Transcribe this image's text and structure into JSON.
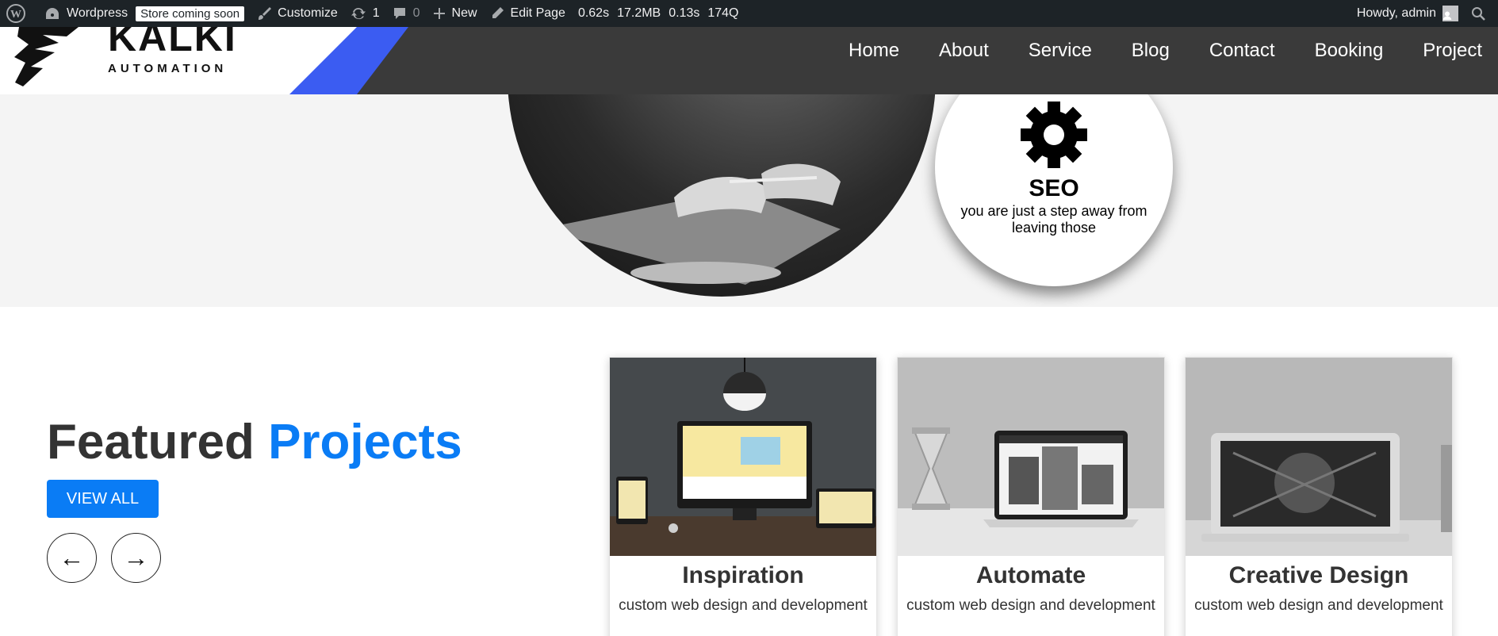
{
  "adminbar": {
    "site_name": "Wordpress",
    "badge": "Store coming soon",
    "customize": "Customize",
    "updates_count": "1",
    "comments_count": "0",
    "new_label": "New",
    "edit_label": "Edit Page",
    "stats": [
      "0.62s",
      "17.2MB",
      "0.13s",
      "174Q"
    ],
    "greeting": "Howdy, admin"
  },
  "header": {
    "logo_text": "KALKI",
    "logo_sub": "AUTOMATION",
    "nav": [
      "Home",
      "About",
      "Service",
      "Blog",
      "Contact",
      "Booking",
      "Project"
    ],
    "accent_color": "#3b5cf2"
  },
  "hero": {
    "seo_title": "SEO",
    "seo_desc": "you are just a step away from leaving those"
  },
  "projects": {
    "heading_part1": "Featured",
    "heading_part2": "Projects",
    "view_all": "VIEW ALL",
    "prev_arrow": "←",
    "next_arrow": "→",
    "accent_color": "#0a7cf5",
    "cards": [
      {
        "title": "Inspiration",
        "desc": "custom web design and development"
      },
      {
        "title": "Automate",
        "desc": "custom web design and development"
      },
      {
        "title": "Creative Design",
        "desc": "custom web design and development"
      }
    ]
  }
}
